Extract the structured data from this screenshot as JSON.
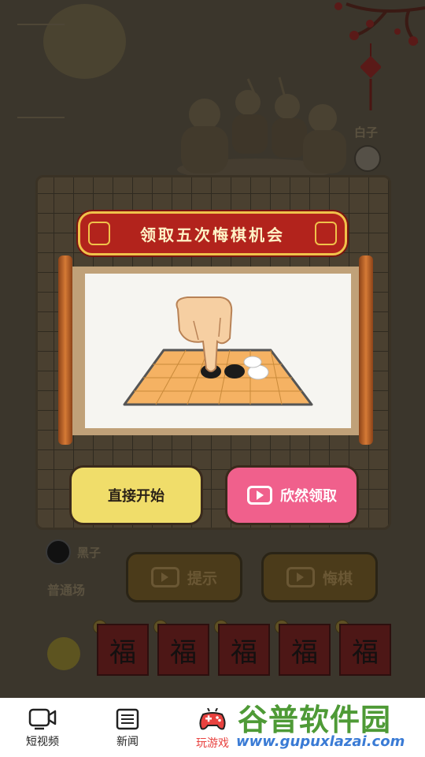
{
  "game": {
    "white_label": "白子",
    "black_label": "黑子",
    "mode_label": "普通场",
    "hint_label": "提示",
    "undo_label": "悔棋",
    "fu_chars": [
      "福",
      "福",
      "福",
      "福",
      "福"
    ]
  },
  "popup": {
    "title": "领取五次悔棋机会",
    "start_label": "直接开始",
    "claim_label": "欣然领取"
  },
  "nav": {
    "items": [
      {
        "label": "短视频",
        "icon": "video-icon"
      },
      {
        "label": "新闻",
        "icon": "list-icon"
      },
      {
        "label": "玩游戏",
        "icon": "gamepad-icon"
      },
      {
        "label": "",
        "icon": ""
      },
      {
        "label": "",
        "icon": ""
      }
    ],
    "active_index": 2
  },
  "watermark": {
    "title": "谷普软件园",
    "url": "www.gupuxlazai.com"
  },
  "colors": {
    "accent": "#e8423f",
    "start_button": "#f0dd6a",
    "claim_button": "#f0608c",
    "banner": "#b2231c",
    "banner_border": "#f0c24a"
  }
}
